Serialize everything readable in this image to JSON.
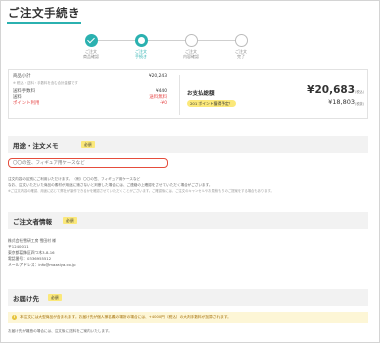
{
  "page": {
    "title": "ご注文手続き"
  },
  "steps": [
    {
      "label": "ご注文\n商品確認",
      "state": "done"
    },
    {
      "label": "ご注文\n手続き",
      "state": "current"
    },
    {
      "label": "ご注文\n内容確認",
      "state": "todo"
    },
    {
      "label": "ご注文\n完了",
      "state": "todo"
    }
  ],
  "summary": {
    "rows": [
      {
        "key": "商品小計",
        "value": "¥20,243",
        "style": "normal"
      },
      {
        "key": "※ 税込・送料・手数料を含む合計金額です",
        "value": "",
        "style": "small"
      },
      {
        "key": "送料手数料",
        "value": "¥440",
        "style": "normal"
      },
      {
        "key": "送料",
        "value": "送料無料",
        "style": "red"
      },
      {
        "key": "ポイント利用",
        "value": "-¥0",
        "style": "red"
      }
    ],
    "payment_label": "お支払総額",
    "points_badge": "201 ポイント獲得予定！",
    "total": "¥20,683",
    "total_note": "(税込)",
    "subtotal": "¥18,803",
    "subtotal_note": "(税抜)"
  },
  "memo": {
    "title": "用途・注文メモ",
    "required": "必須",
    "placeholder": "〇〇の笠、フィギュア用ケースなど",
    "notes": [
      "注文内容の区別にご利用いただけます。（例）〇〇の笠、フィギュア用ケースなど",
      "なお、注文いただいた商品の素材が用途に適さないと判断した場合には、ご連絡の上確認をさせていただく場合がございます。",
      "※ご注文内容の確認、用途に応じて弊社が製作できるかを確認させていただくことがございます。ご確認後には、ご注文のキャンセルやお見積もりのご提案をする場合もあります。"
    ]
  },
  "orderer": {
    "title": "ご注文者情報",
    "required": "必須",
    "lines": [
      "株式会社雪研工房 雪田村 様",
      "〒1240011",
      "東京都葛飾区四つ木3-8-16",
      "電話番号：0336955512",
      "メールアドレス：info@mazaiya.co.jp"
    ]
  },
  "delivery": {
    "title": "お届け先",
    "required": "必須",
    "info": "!",
    "notice": "本注文には大型商品が含まれます。お届け先が個人様名義の場所の場合には、+4000円（税込）の大判手数料が加算されます。",
    "note": "お届け先が離島の場合には、注文後に送料をご案内いたします。"
  }
}
